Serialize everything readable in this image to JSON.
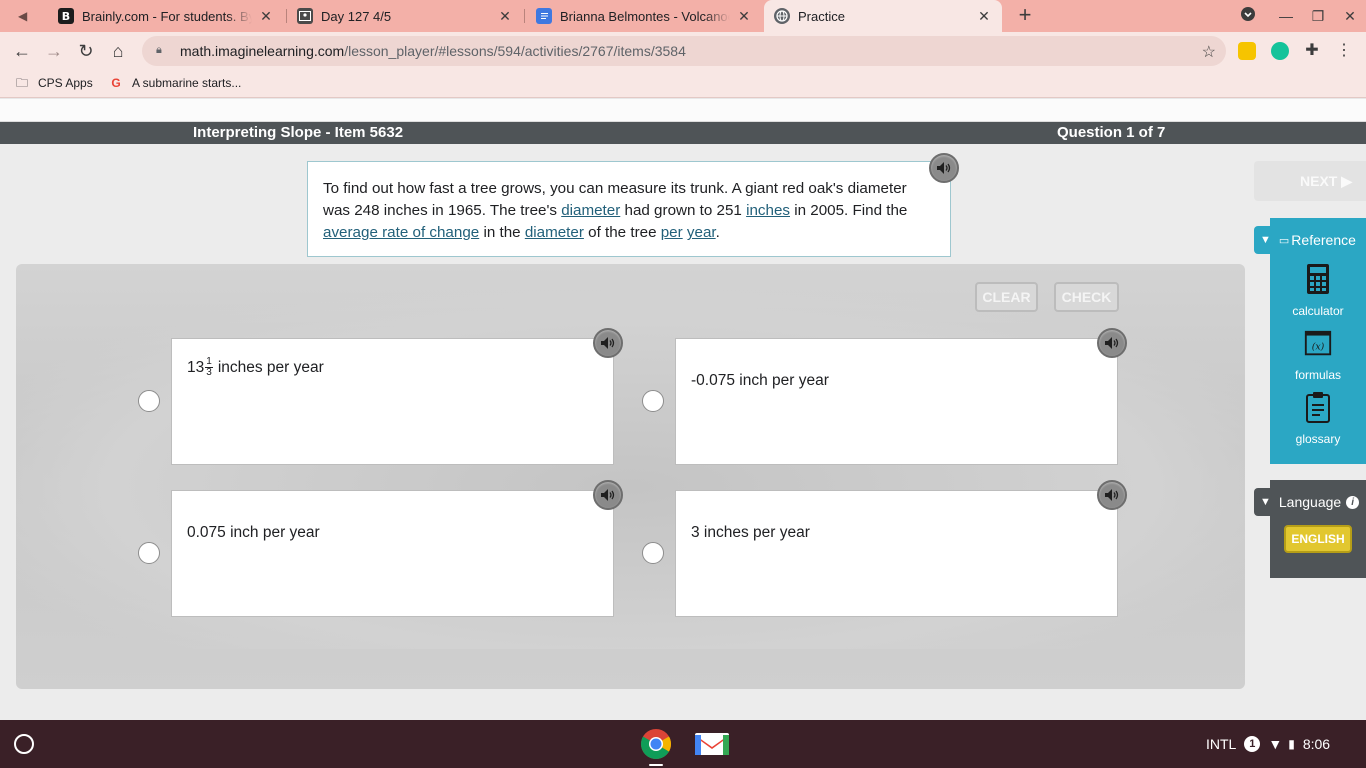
{
  "browser": {
    "tabs": [
      {
        "title": "Brainly.com - For students. By students",
        "favicon": "B"
      },
      {
        "title": "Day 127 4/5",
        "favicon": "classroom-icon"
      },
      {
        "title": "Brianna Belmontes - Volcanoes Notes",
        "favicon": "docs-icon"
      },
      {
        "title": "Practice",
        "favicon": "globe-icon"
      }
    ],
    "url_host": "math.imaginelearning.com",
    "url_path": "/lesson_player/#lessons/594/activities/2767/items/3584",
    "bookmarks": [
      {
        "label": "CPS Apps",
        "icon": "folder-icon"
      },
      {
        "label": "A submarine starts...",
        "icon": "google-icon"
      }
    ]
  },
  "lesson": {
    "title": "Interpreting Slope - Item 5632",
    "progress": "Question 1 of 7",
    "prompt": {
      "p1": "To find out how fast a tree grows, you can measure its trunk. A giant red oak's diameter was 248 inches in 1965. The tree's ",
      "l1": "diameter",
      "p2": " had grown to 251 ",
      "l2": "inches",
      "p3": " in 2005. Find the ",
      "l3": "average rate of change",
      "p4": " in the ",
      "l4": "diameter",
      "p5": " of the tree ",
      "l5": "per",
      "p6": " ",
      "l6": "year",
      "p7": "."
    },
    "buttons": {
      "clear": "CLEAR",
      "check": "CHECK",
      "next": "NEXT ▶"
    },
    "choices": [
      {
        "whole": "13",
        "num": "1",
        "den": "3",
        "text": "inches per year"
      },
      {
        "text": "-0.075 inch per year"
      },
      {
        "text": "0.075 inch per year"
      },
      {
        "text": "3 inches per year"
      }
    ]
  },
  "sidebar": {
    "reference_label": "Reference",
    "items": [
      {
        "label": "calculator",
        "icon": "calculator-icon"
      },
      {
        "label": "formulas",
        "icon": "formulas-icon"
      },
      {
        "label": "glossary",
        "icon": "glossary-icon"
      }
    ],
    "language_label": "Language",
    "language_button": "ENGLISH"
  },
  "taskbar": {
    "input_method": "INTL",
    "notification_count": "1",
    "time": "8:06"
  },
  "colors": {
    "tabstrip": "#f3b0a8",
    "header": "#4f5457",
    "reference": "#2ba7c4",
    "language_button": "#e2c72f",
    "link": "#22607a"
  }
}
